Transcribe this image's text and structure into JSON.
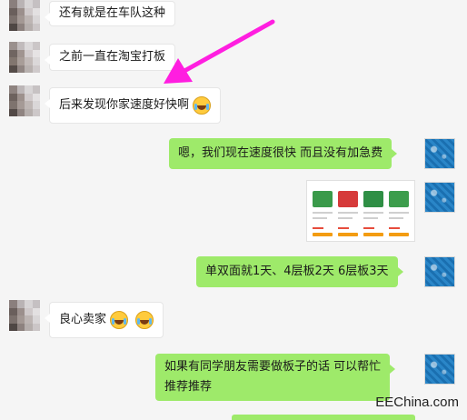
{
  "colors": {
    "sent_bubble": "#9eea6a",
    "recv_bubble": "#ffffff",
    "background": "#f5f5f5",
    "arrow": "#ff1ee0"
  },
  "messages": [
    {
      "side": "left",
      "text": "还有就是在车队这种",
      "emoji": []
    },
    {
      "side": "left",
      "text": "之前一直在淘宝打板",
      "emoji": []
    },
    {
      "side": "left",
      "text": "后来发现你家速度好快啊",
      "emoji": [
        "laugh-cry-emoji"
      ]
    },
    {
      "side": "right",
      "text": "嗯，我们现在速度很快   而且没有加急费",
      "emoji": []
    },
    {
      "side": "right",
      "type": "image",
      "image_desc": "pcb-product-screenshot"
    },
    {
      "side": "right",
      "text": "单双面就1天、4层板2天   6层板3天",
      "emoji": []
    },
    {
      "side": "left",
      "text": "良心卖家",
      "emoji": [
        "laugh-cry-emoji",
        "laugh-cry-emoji"
      ]
    },
    {
      "side": "right",
      "text_line1": "如果有同学朋友需要做板子的话   可以帮忙",
      "text_line2": "推荐推荐"
    }
  ],
  "watermark": "EEChina.com"
}
